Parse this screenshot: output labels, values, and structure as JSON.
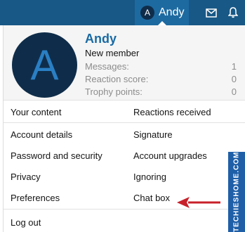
{
  "topbar": {
    "avatar_letter": "A",
    "username": "Andy",
    "mail_icon": "envelope-icon",
    "bell_icon": "bell-icon"
  },
  "profile": {
    "avatar_letter": "A",
    "name": "Andy",
    "title": "New member",
    "stats": [
      {
        "label": "Messages:",
        "value": "1"
      },
      {
        "label": "Reaction score:",
        "value": "0"
      },
      {
        "label": "Trophy points:",
        "value": "0"
      }
    ]
  },
  "menu": {
    "your_content": "Your content",
    "reactions_received": "Reactions received",
    "account_details": "Account details",
    "signature": "Signature",
    "password_security": "Password and security",
    "account_upgrades": "Account upgrades",
    "privacy": "Privacy",
    "ignoring": "Ignoring",
    "preferences": "Preferences",
    "chat_box": "Chat box",
    "log_out": "Log out"
  },
  "watermark": "TECHIESHOME.COM",
  "colors": {
    "topbar": "#185886",
    "accent": "#1a6aa3",
    "avatar_bg": "#0f2d4a",
    "arrow": "#c8202a"
  }
}
